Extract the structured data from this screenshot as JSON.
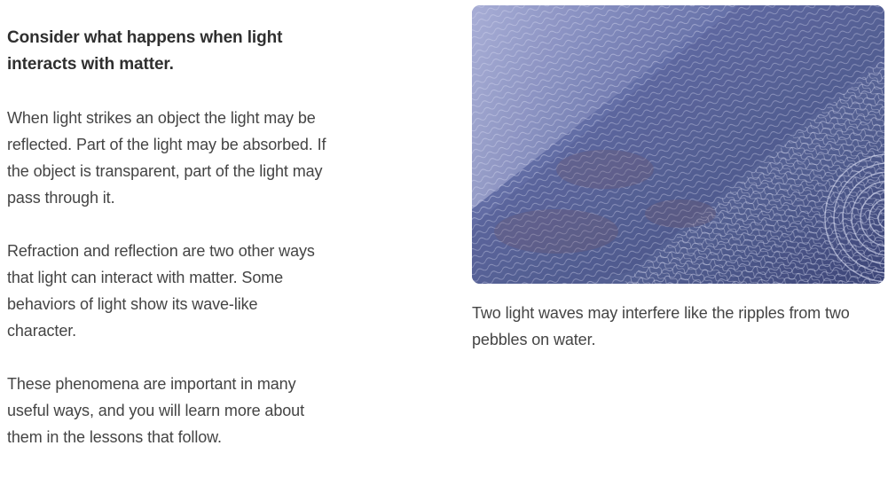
{
  "content": {
    "heading": "Consider what happens when light interacts with matter.",
    "paragraphs": [
      "When light strikes an object the light may be reflected. Part of the light may be absorbed. If the object is transparent, part of the light may pass through it.",
      "Refraction and reflection are two other ways that light can interact with matter. Some behaviors of light show its wave-like character.",
      "These phenomena are important in many useful ways, and you will learn more about them in the lessons that follow."
    ]
  },
  "figure": {
    "image_subject": "water-ripples-photo",
    "caption": "Two light waves may interfere like the ripples from two pebbles on water.",
    "colors": {
      "light": "#b9bfe3",
      "mid": "#6f79b3",
      "dark": "#3d4680"
    }
  }
}
